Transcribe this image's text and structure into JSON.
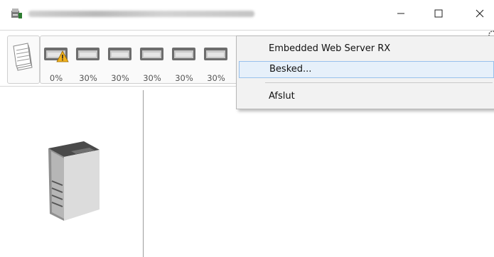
{
  "window": {
    "title_obscured": true,
    "controls": [
      "minimize",
      "maximize",
      "close"
    ]
  },
  "toolbar": {
    "paper_icon": "paper-stack-icon",
    "trays": [
      {
        "percent": "0%",
        "warning": true
      },
      {
        "percent": "30%",
        "warning": false
      },
      {
        "percent": "30%",
        "warning": false
      },
      {
        "percent": "30%",
        "warning": false
      },
      {
        "percent": "30%",
        "warning": false
      },
      {
        "percent": "30%",
        "warning": false
      }
    ]
  },
  "context_menu": {
    "items": [
      {
        "label": "Embedded Web Server RX",
        "highlighted": false
      },
      {
        "label": "Besked...",
        "highlighted": true
      },
      {
        "label": "Afslut",
        "highlighted": false
      }
    ]
  },
  "colors": {
    "warning": "#f2b21d",
    "menu_highlight": "#e6f0fa",
    "menu_highlight_border": "#98c1ec"
  }
}
